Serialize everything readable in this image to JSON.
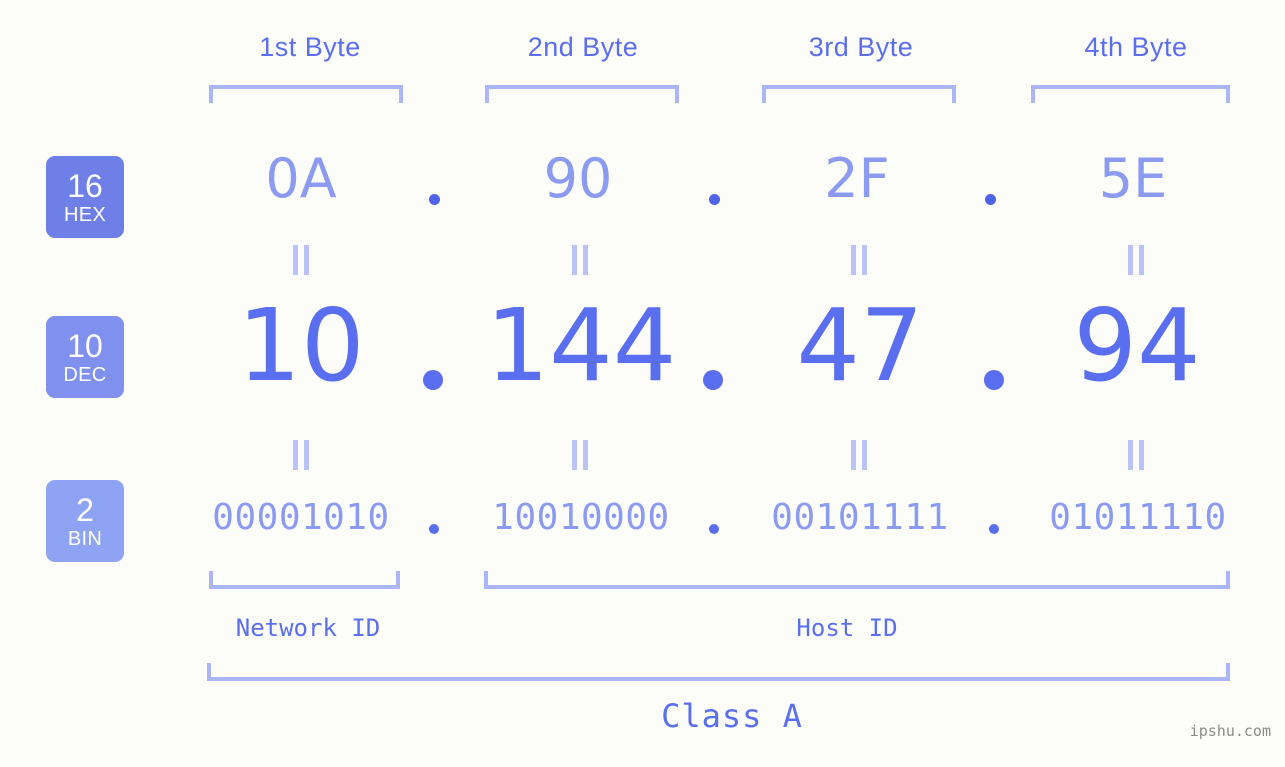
{
  "meta": {
    "background_color": "#fcfdf8",
    "accent_color": "#5a6ef0",
    "light_accent_color": "#8b9bf2",
    "bracket_color": "#aab6f7"
  },
  "byte_headers": [
    {
      "label": "1st Byte"
    },
    {
      "label": "2nd Byte"
    },
    {
      "label": "3rd Byte"
    },
    {
      "label": "4th Byte"
    }
  ],
  "rows": {
    "hex": {
      "badge_number": "16",
      "badge_name": "HEX",
      "badge_color": "#6f7fe8",
      "values": [
        "0A",
        "90",
        "2F",
        "5E"
      ],
      "separator": "."
    },
    "dec": {
      "badge_number": "10",
      "badge_name": "DEC",
      "badge_color": "#8090ee",
      "values": [
        "10",
        "144",
        "47",
        "94"
      ],
      "separator": "."
    },
    "bin": {
      "badge_number": "2",
      "badge_name": "BIN",
      "badge_color": "#8ea3f4",
      "values": [
        "00001010",
        "10010000",
        "00101111",
        "01011110"
      ],
      "separator": "."
    }
  },
  "equality_marks": {
    "symbol": "||",
    "count_per_row": 4
  },
  "id_sections": [
    {
      "label": "Network ID"
    },
    {
      "label": "Host ID"
    }
  ],
  "class_section": {
    "label": "Class A"
  },
  "watermark": {
    "text": "ipshu.com"
  }
}
